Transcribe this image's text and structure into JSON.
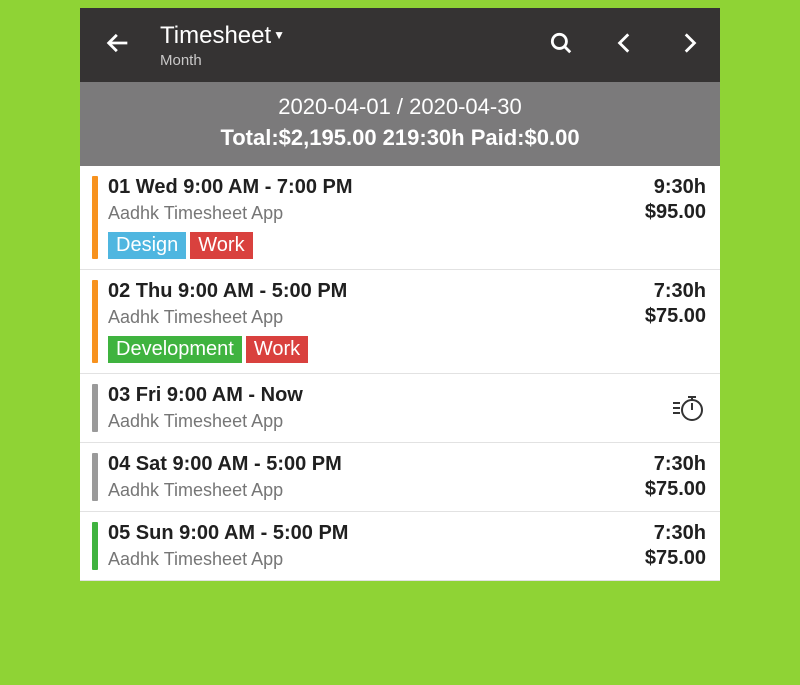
{
  "header": {
    "title": "Timesheet",
    "subtitle": "Month"
  },
  "summary": {
    "range": "2020-04-01 / 2020-04-30",
    "totals": "Total:$2,195.00 219:30h Paid:$0.00"
  },
  "colors": {
    "orange": "#f7921e",
    "grey": "#9a9a9a",
    "green": "#3fb33f",
    "tag_blue": "#4fb6e0",
    "tag_red": "#d9413e",
    "tag_green": "#3fb33f"
  },
  "entries": [
    {
      "stripe": "orange",
      "line": "01 Wed  9:00 AM - 7:00 PM",
      "project": "Aadhk  Timesheet App",
      "duration": "9:30h",
      "amount": "$95.00",
      "tags": [
        {
          "label": "Design",
          "color": "tag_blue"
        },
        {
          "label": "Work",
          "color": "tag_red"
        }
      ]
    },
    {
      "stripe": "orange",
      "line": "02 Thu  9:00 AM - 5:00 PM",
      "project": "Aadhk  Timesheet App",
      "duration": "7:30h",
      "amount": "$75.00",
      "tags": [
        {
          "label": "Development",
          "color": "tag_green"
        },
        {
          "label": "Work",
          "color": "tag_red"
        }
      ]
    },
    {
      "stripe": "grey",
      "line": "03 Fri  9:00 AM - Now",
      "project": "Aadhk  Timesheet App",
      "running": true
    },
    {
      "stripe": "grey",
      "line": "04 Sat  9:00 AM - 5:00 PM",
      "project": "Aadhk  Timesheet App",
      "duration": "7:30h",
      "amount": "$75.00"
    },
    {
      "stripe": "green",
      "line": "05 Sun  9:00 AM - 5:00 PM",
      "project": "Aadhk  Timesheet App",
      "duration": "7:30h",
      "amount": "$75.00"
    }
  ]
}
